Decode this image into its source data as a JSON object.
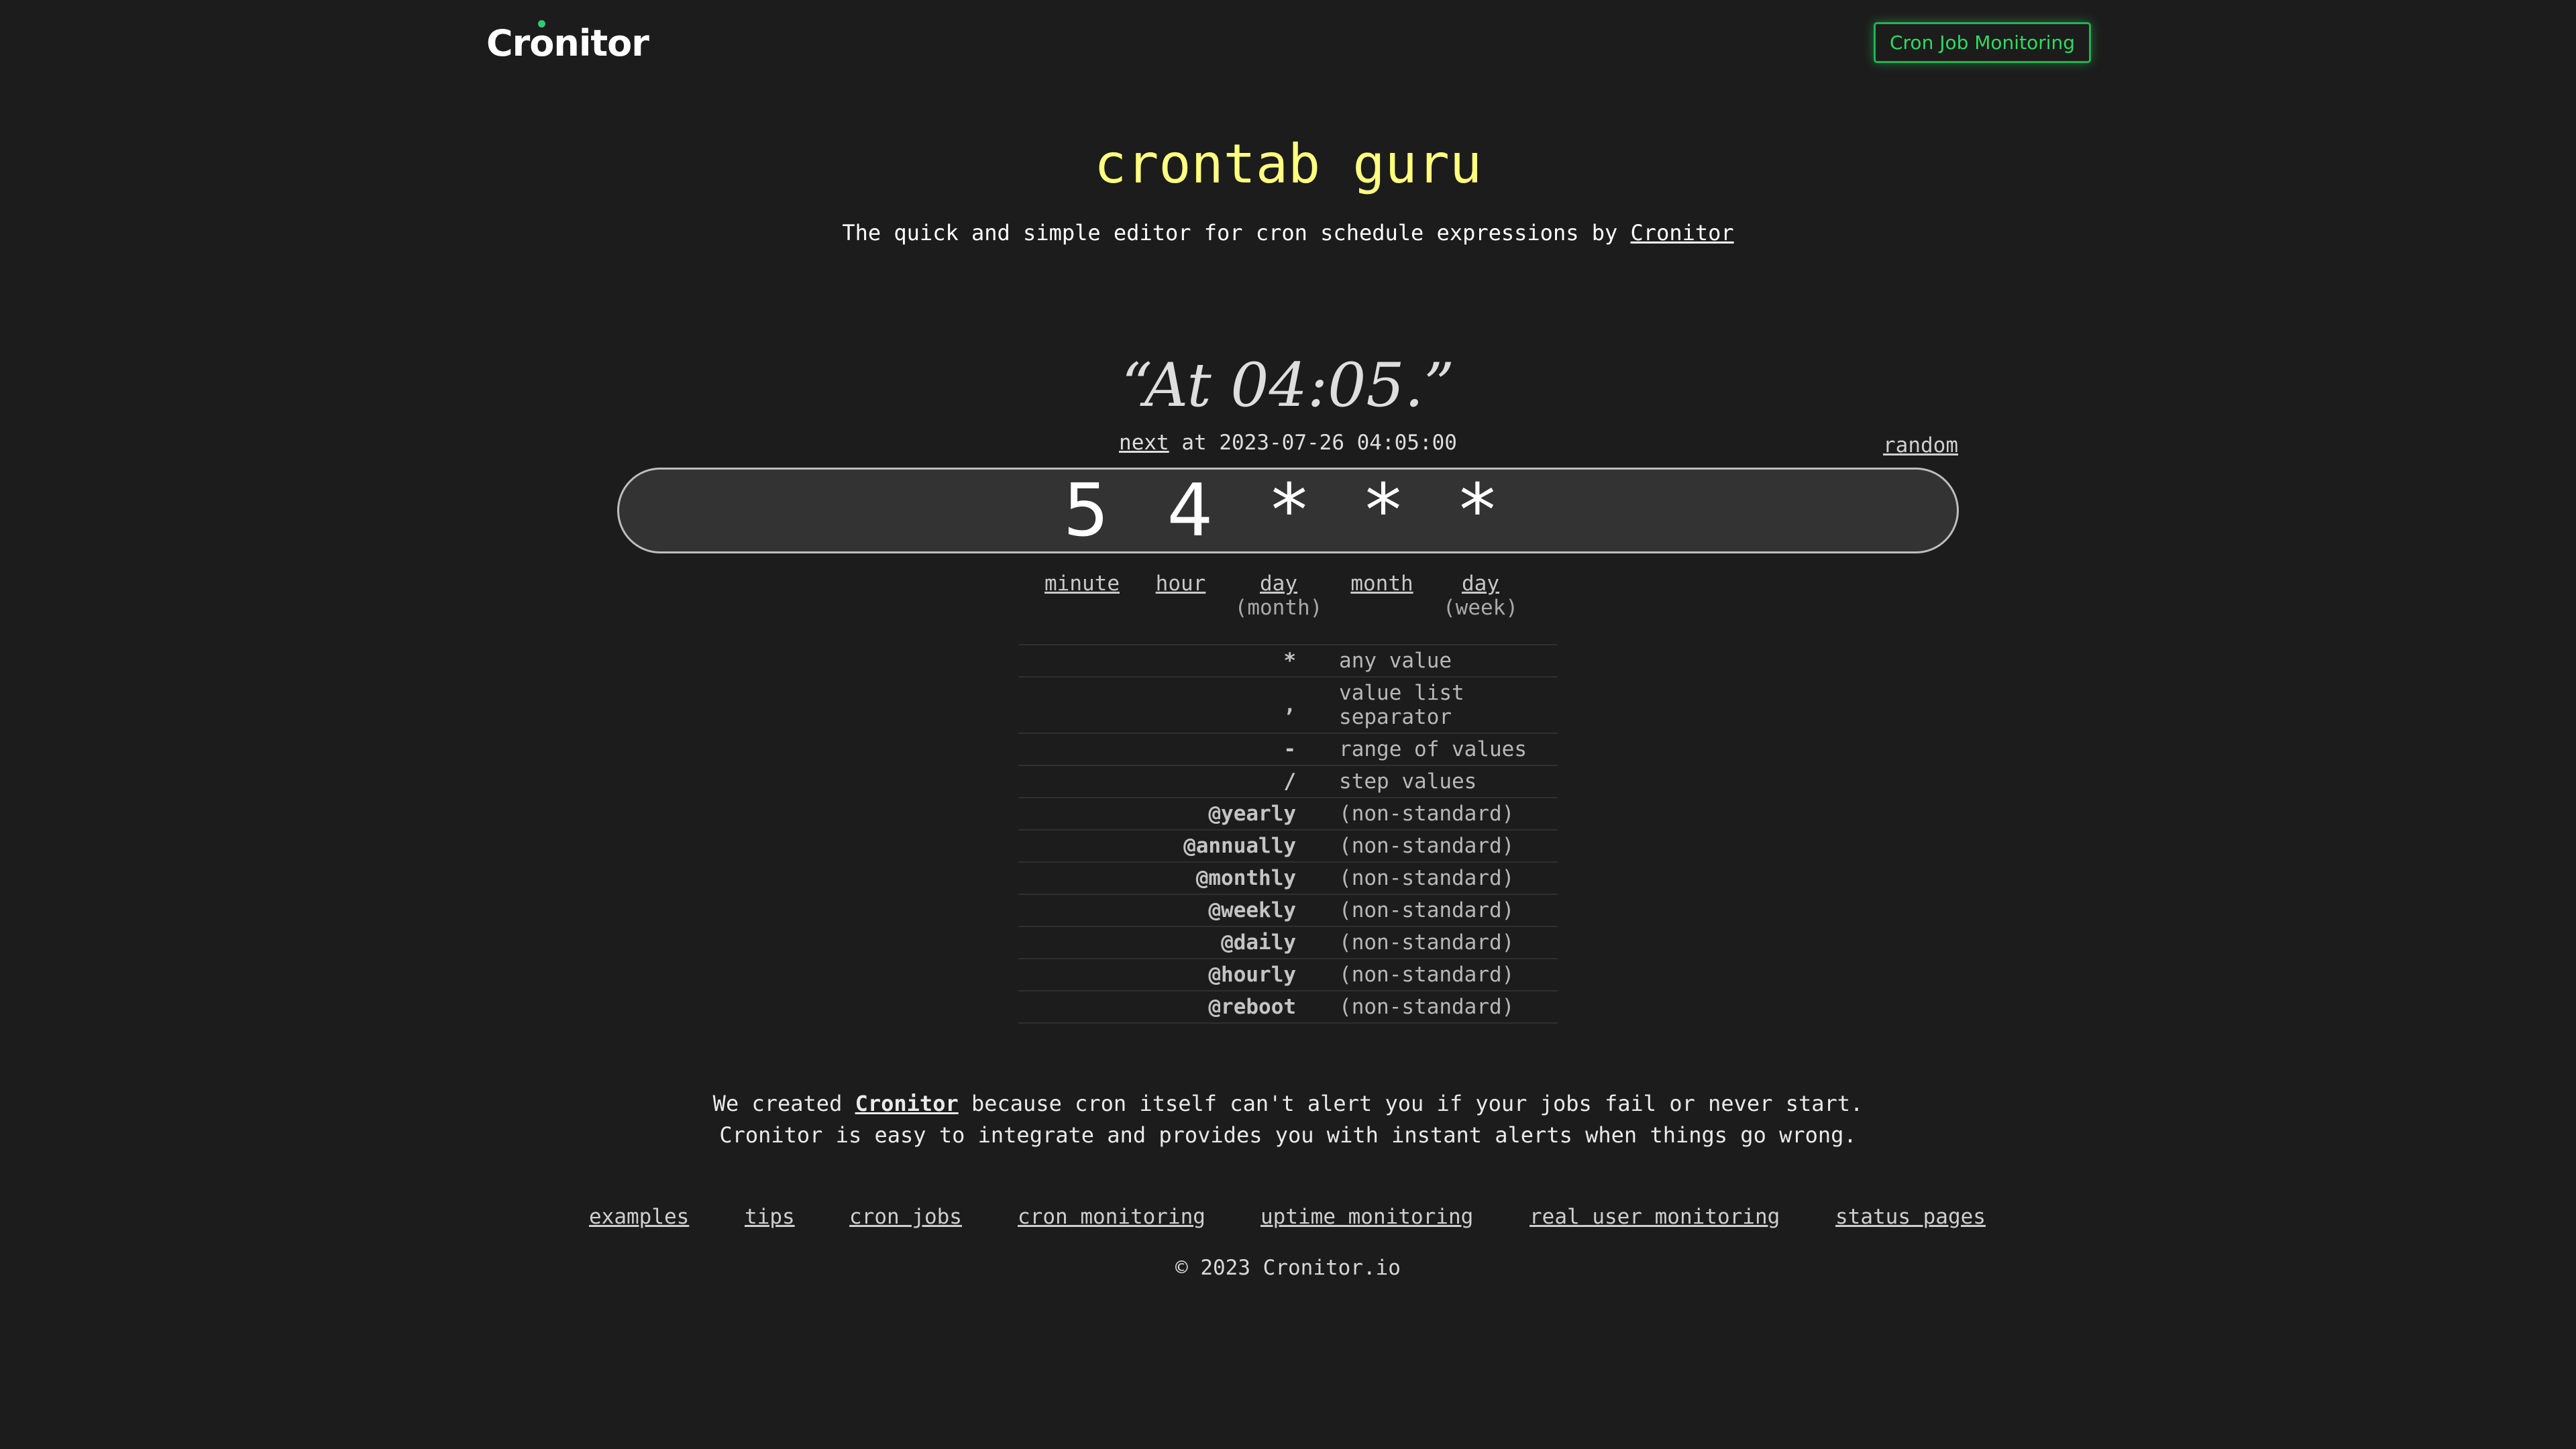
{
  "header": {
    "logo_prefix": "Cr",
    "logo_o": "o",
    "logo_suffix": "nitor",
    "cta_label": "Cron Job Monitoring"
  },
  "hero": {
    "title": "crontab guru",
    "subtitle_prefix": "The quick and simple editor for cron schedule expressions by ",
    "subtitle_link": "Cronitor"
  },
  "schedule": {
    "human_readable": "“At 04:05.”",
    "next_label": "next",
    "next_text": " at 2023-07-26 04:05:00",
    "random_label": "random",
    "expression": "5 4 * * *"
  },
  "parts": [
    {
      "label": "minute",
      "sub": ""
    },
    {
      "label": "hour",
      "sub": ""
    },
    {
      "label": "day",
      "sub": "(month)"
    },
    {
      "label": "month",
      "sub": ""
    },
    {
      "label": "day",
      "sub": "(week)"
    }
  ],
  "reference": [
    {
      "symbol": "*",
      "desc": "any value"
    },
    {
      "symbol": ",",
      "desc": "value list separator"
    },
    {
      "symbol": "-",
      "desc": "range of values"
    },
    {
      "symbol": "/",
      "desc": "step values"
    },
    {
      "symbol": "@yearly",
      "desc": "(non-standard)"
    },
    {
      "symbol": "@annually",
      "desc": "(non-standard)"
    },
    {
      "symbol": "@monthly",
      "desc": "(non-standard)"
    },
    {
      "symbol": "@weekly",
      "desc": "(non-standard)"
    },
    {
      "symbol": "@daily",
      "desc": "(non-standard)"
    },
    {
      "symbol": "@hourly",
      "desc": "(non-standard)"
    },
    {
      "symbol": "@reboot",
      "desc": "(non-standard)"
    }
  ],
  "promo": {
    "line1_prefix": "We created ",
    "line1_link": "Cronitor",
    "line1_suffix": " because cron itself can't alert you if your jobs fail or never start.",
    "line2": "Cronitor is easy to integrate and provides you with instant alerts when things go wrong."
  },
  "footer": {
    "links": [
      "examples",
      "tips",
      "cron jobs",
      "cron monitoring",
      "uptime monitoring",
      "real user monitoring",
      "status pages"
    ],
    "copyright": "© 2023 Cronitor.io"
  },
  "colors": {
    "background": "#1c1c1c",
    "title": "#ffff80",
    "accent_green": "#2edb63"
  }
}
